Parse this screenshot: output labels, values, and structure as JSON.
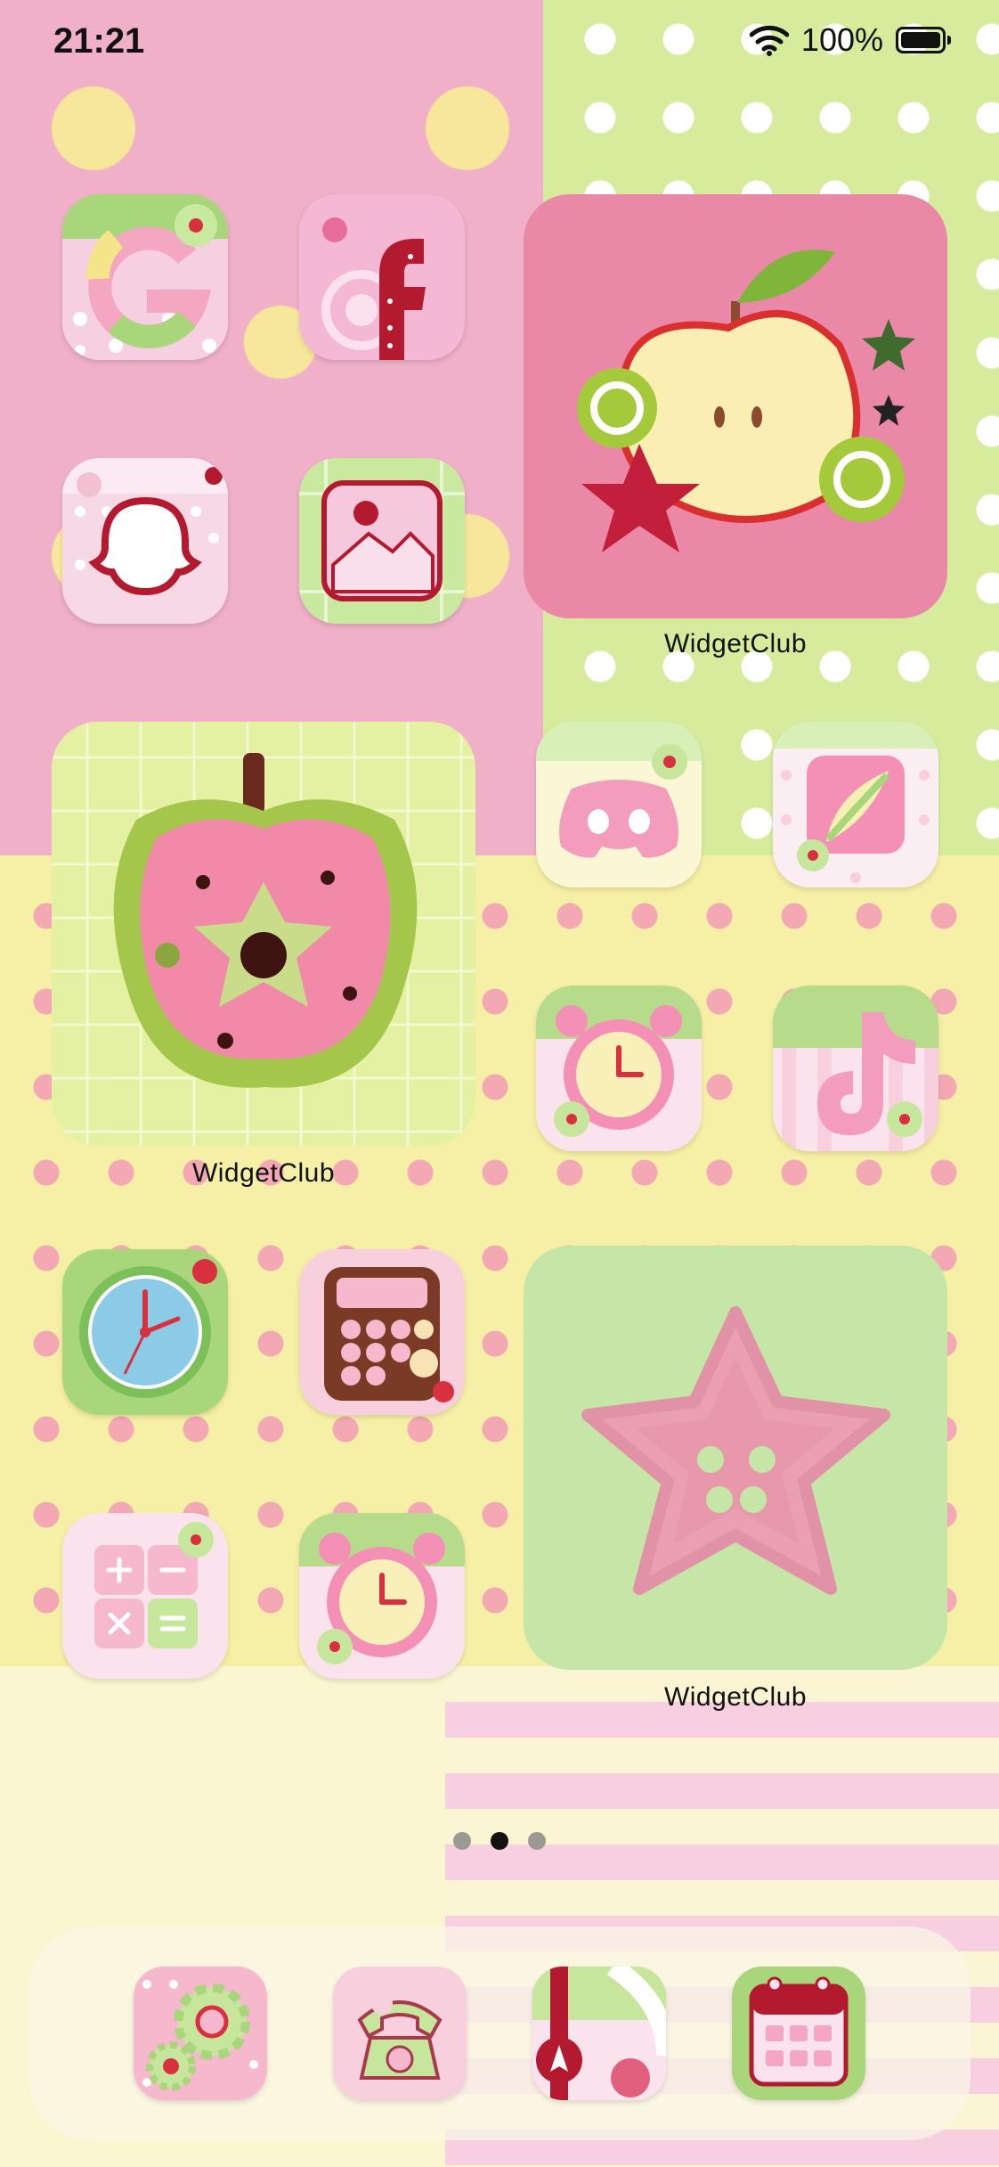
{
  "status_bar": {
    "time": "21:21",
    "battery": "100%"
  },
  "widgets": [
    {
      "label": "WidgetClub",
      "image": "apple-slice-image"
    },
    {
      "label": "WidgetClub",
      "image": "quilted-apple-image"
    },
    {
      "label": "WidgetClub",
      "image": "star-button-image"
    }
  ],
  "apps": [
    {
      "name": "google-app-icon"
    },
    {
      "name": "facebook-app-icon"
    },
    {
      "name": "snapchat-app-icon"
    },
    {
      "name": "photos-app-icon"
    },
    {
      "name": "discord-app-icon"
    },
    {
      "name": "procreate-app-icon"
    },
    {
      "name": "clock-app-icon"
    },
    {
      "name": "tiktok-app-icon"
    },
    {
      "name": "clock-face-app-icon"
    },
    {
      "name": "calculator-app-icon"
    },
    {
      "name": "calculator-grid-app-icon"
    },
    {
      "name": "alarm-app-icon"
    }
  ],
  "dock": [
    {
      "name": "settings-app-icon"
    },
    {
      "name": "phone-app-icon"
    },
    {
      "name": "maps-app-icon"
    },
    {
      "name": "calendar-app-icon"
    }
  ],
  "page_indicator": {
    "count": 3,
    "active": 2
  }
}
